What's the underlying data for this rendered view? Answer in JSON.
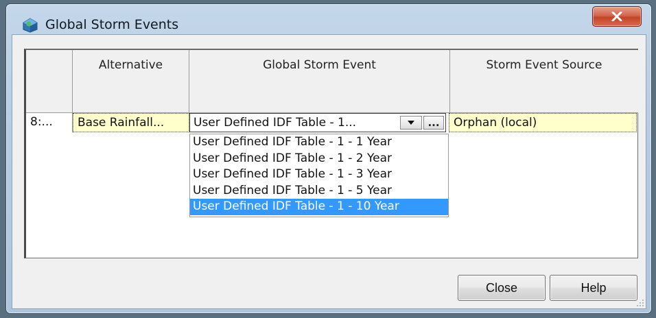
{
  "window": {
    "title": "Global Storm Events",
    "icons": [
      "app-icon",
      "close-icon"
    ]
  },
  "table": {
    "columns": [
      "",
      "Alternative",
      "Global Storm Event",
      "Storm Event Source"
    ],
    "rows": [
      {
        "id": "8:...",
        "alternative": "Base Rainfall...",
        "global_storm_event": "User Defined IDF Table - 1...",
        "storm_event_source": "Orphan (local)"
      }
    ],
    "combo_ellipsis": "..."
  },
  "dropdown": {
    "options": [
      "User Defined IDF Table - 1 - 1 Year",
      "User Defined IDF Table - 1 - 2 Year",
      "User Defined IDF Table - 1 - 3 Year",
      "User Defined IDF Table - 1 - 5 Year",
      "User Defined IDF Table - 1 - 10 Year"
    ],
    "selected_option": "User Defined IDF Table - 1 - 10 Year"
  },
  "buttons": {
    "close": "Close",
    "help": "Help"
  },
  "colors": {
    "selection": "#3399ff",
    "row_highlight": "#ffffcc",
    "close_button": "#c24528"
  }
}
